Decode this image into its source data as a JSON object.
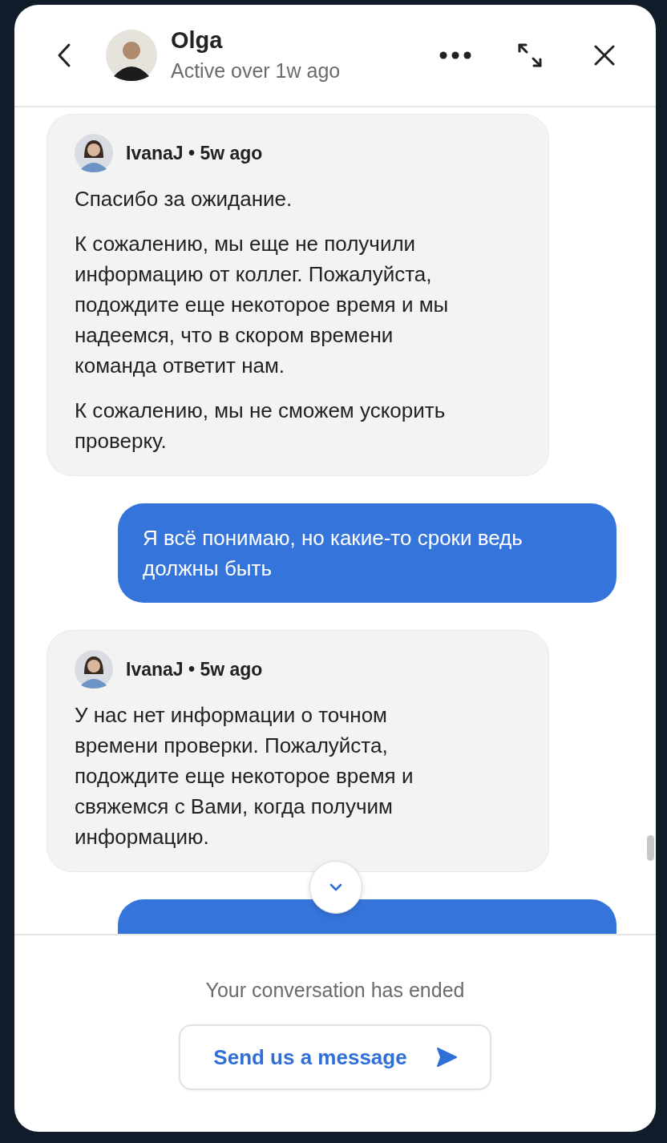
{
  "header": {
    "name": "Olga",
    "status": "Active over 1w ago"
  },
  "messages": [
    {
      "kind": "incoming",
      "meta": "IvanaJ • 5w ago",
      "paragraphs": [
        "Спасибо за ожидание.",
        "К сожалению, мы еще не получили информацию от коллег. Пожалуйста, подождите еще некоторое время и мы надеемся, что в скором времени команда ответит нам.",
        "К сожалению, мы не сможем ускорить проверку."
      ]
    },
    {
      "kind": "outgoing",
      "paragraphs": [
        "Я всё понимаю, но какие-то сроки ведь должны быть"
      ]
    },
    {
      "kind": "incoming",
      "meta": "IvanaJ • 5w ago",
      "paragraphs": [
        "У нас нет информации о точном времени проверки. Пожалуйста, подождите еще некоторое время и свяжемся с Вами, когда получим информацию."
      ]
    },
    {
      "kind": "outgoing"
    }
  ],
  "footer": {
    "notice": "Your conversation has ended",
    "button": "Send us a message"
  }
}
